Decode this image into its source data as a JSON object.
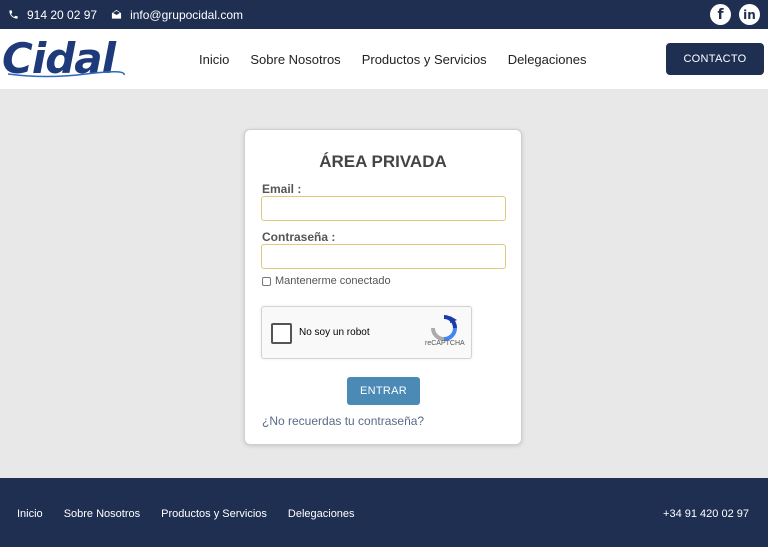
{
  "topbar": {
    "phone": "914 20 02 97",
    "email": "info@grupocidal.com",
    "social": [
      {
        "icon": "facebook-icon",
        "glyph": "f"
      },
      {
        "icon": "linkedin-icon",
        "glyph": "in"
      }
    ]
  },
  "header": {
    "logo_text": "Cidal",
    "nav": [
      "Inicio",
      "Sobre Nosotros",
      "Productos y Servicios",
      "Delegaciones"
    ],
    "contact_button": "CONTACTO"
  },
  "login": {
    "title": "ÁREA PRIVADA",
    "email_label": "Email :",
    "email_value": "",
    "password_label": "Contraseña :",
    "password_value": "",
    "remember_label": "Mantenerme conectado",
    "remember_checked": false,
    "captcha_label": "No soy un robot",
    "captcha_brand": "reCAPTCHA",
    "submit_label": "ENTRAR",
    "forgot_label": "¿No recuerdas tu contraseña?"
  },
  "footer": {
    "nav": [
      "Inicio",
      "Sobre Nosotros",
      "Productos y Servicios",
      "Delegaciones"
    ],
    "phone": "+34 91 420 02 97"
  },
  "colors": {
    "navy": "#1f2f52",
    "logo_blue": "#1f3a7a",
    "button_blue": "#4a8ab5",
    "input_border": "#e0c97a",
    "page_bg": "#e8e8e8"
  }
}
